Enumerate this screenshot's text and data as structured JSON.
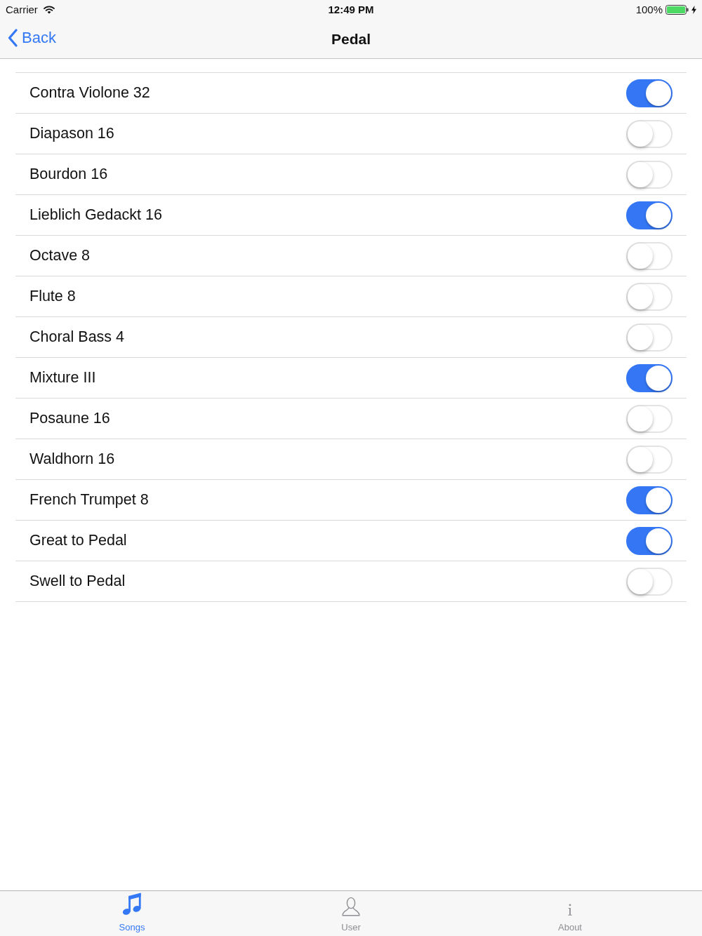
{
  "status_bar": {
    "carrier": "Carrier",
    "time": "12:49 PM",
    "battery": "100%"
  },
  "nav_bar": {
    "back": "Back",
    "title": "Pedal"
  },
  "stops": [
    {
      "name": "Contra Violone 32",
      "on": true
    },
    {
      "name": "Diapason 16",
      "on": false
    },
    {
      "name": "Bourdon 16",
      "on": false
    },
    {
      "name": "Lieblich Gedackt 16",
      "on": true
    },
    {
      "name": "Octave 8",
      "on": false
    },
    {
      "name": "Flute 8",
      "on": false
    },
    {
      "name": "Choral Bass 4",
      "on": false
    },
    {
      "name": "Mixture III",
      "on": true
    },
    {
      "name": "Posaune 16",
      "on": false
    },
    {
      "name": "Waldhorn 16",
      "on": false
    },
    {
      "name": "French Trumpet 8",
      "on": true
    },
    {
      "name": "Great to Pedal",
      "on": true
    },
    {
      "name": "Swell to Pedal",
      "on": false
    }
  ],
  "tab_bar": {
    "tabs": [
      {
        "kind": "music",
        "label": "Songs",
        "selected": true
      },
      {
        "kind": "user",
        "label": "User",
        "selected": false
      },
      {
        "kind": "info",
        "label": "About",
        "selected": false
      }
    ]
  }
}
